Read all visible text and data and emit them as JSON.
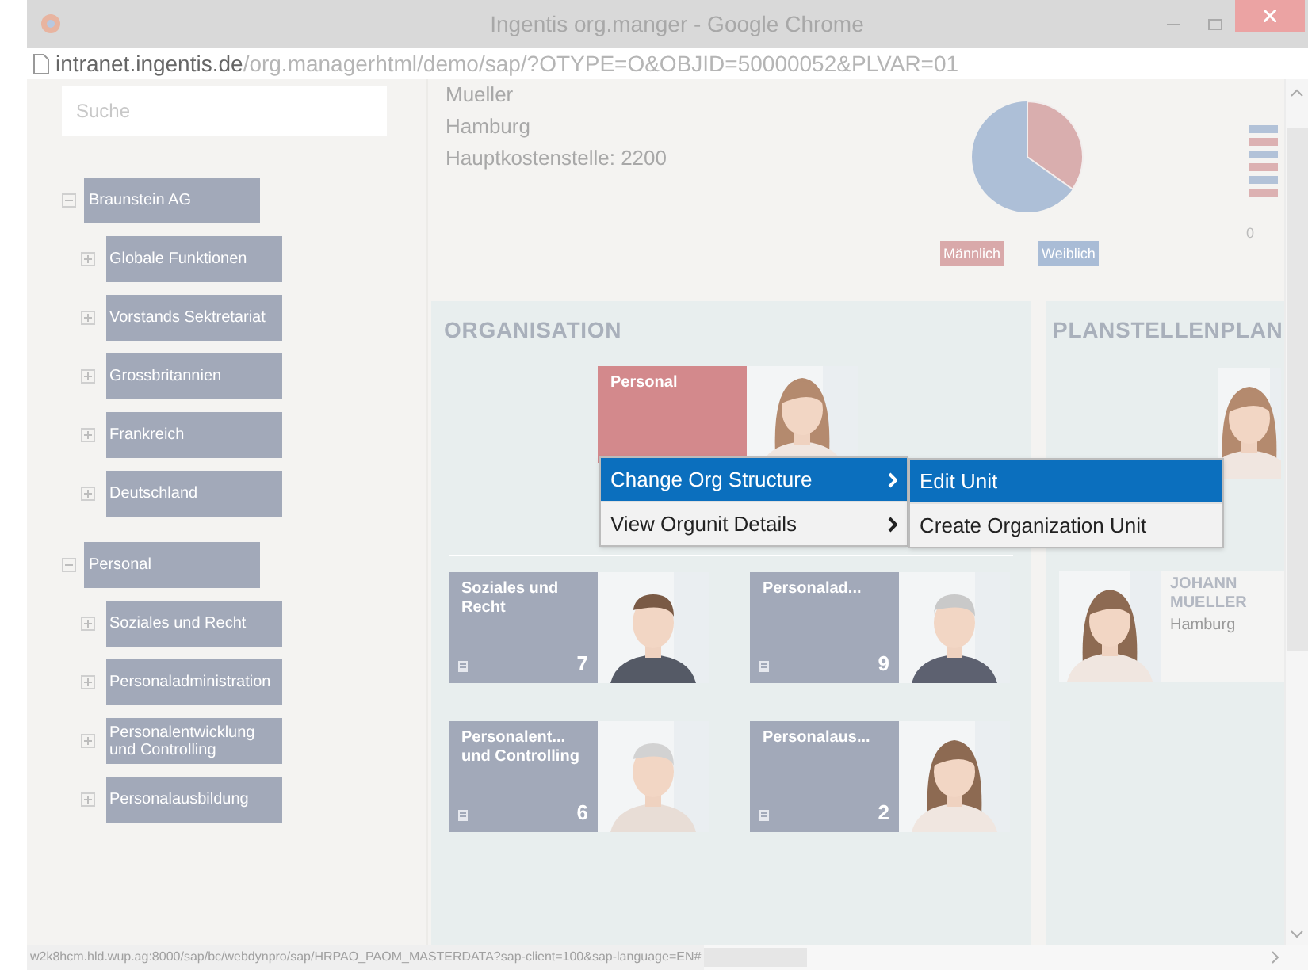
{
  "window": {
    "title": "Ingentis org.manger - Google Chrome"
  },
  "address_bar": {
    "host": "intranet.ingentis.de",
    "path": "/org.managerhtml/demo/sap/?OTYPE=O&OBJID=50000052&PLVAR=01"
  },
  "search": {
    "placeholder": "Suche"
  },
  "tree": [
    {
      "label": "Braunstein AG",
      "expanded": true,
      "children": [
        {
          "label": "Globale Funktionen",
          "expanded": false
        },
        {
          "label": "Vorstands Sektretariat",
          "expanded": false
        },
        {
          "label": "Grossbritannien",
          "expanded": false
        },
        {
          "label": "Frankreich",
          "expanded": false
        },
        {
          "label": "Deutschland",
          "expanded": false
        }
      ]
    },
    {
      "label": "Personal",
      "expanded": true,
      "children": [
        {
          "label": "Soziales und Recht",
          "expanded": false
        },
        {
          "label": "Personaladministration",
          "expanded": false
        },
        {
          "label": "Personalentwicklung und Controlling",
          "expanded": false
        },
        {
          "label": "Personalausbildung",
          "expanded": false
        }
      ]
    }
  ],
  "header": {
    "lines": [
      "Mueller",
      "Hamburg",
      "Hauptkostenstelle: 2200"
    ],
    "legend": [
      {
        "label": "Männlich",
        "color": "#d9a9aa"
      },
      {
        "label": "Weiblich",
        "color": "#a9bcd6"
      }
    ],
    "axis_label": "0"
  },
  "organisation": {
    "heading": "ORGANISATION",
    "root": {
      "title": "Personal",
      "selected": true
    },
    "units": [
      {
        "title": "Soziales und Recht",
        "count": "7",
        "selected": false
      },
      {
        "title": "Personalad...",
        "count": "9",
        "selected": false
      },
      {
        "title": "Personalent... und Controlling",
        "count": "6",
        "selected": false
      },
      {
        "title": "Personalaus...",
        "count": "2",
        "selected": false
      }
    ]
  },
  "context_menu": {
    "items": [
      {
        "label": "Change Org Structure",
        "selected": true
      },
      {
        "label": "View Orgunit Details",
        "selected": false
      }
    ],
    "submenu": [
      {
        "label": "Edit Unit",
        "selected": true
      },
      {
        "label": "Create Organization Unit",
        "selected": false
      }
    ]
  },
  "planstellenplan": {
    "heading": "PLANSTELLENPLAN",
    "person": {
      "name": "JOHANN MUELLER",
      "city": "Hamburg"
    }
  },
  "status_bar": {
    "url": "w2k8hcm.hld.wup.ag:8000/sap/bc/webdynpro/sap/HRPAO_PAOM_MASTERDATA?sap-client=100&sap-language=EN#"
  }
}
